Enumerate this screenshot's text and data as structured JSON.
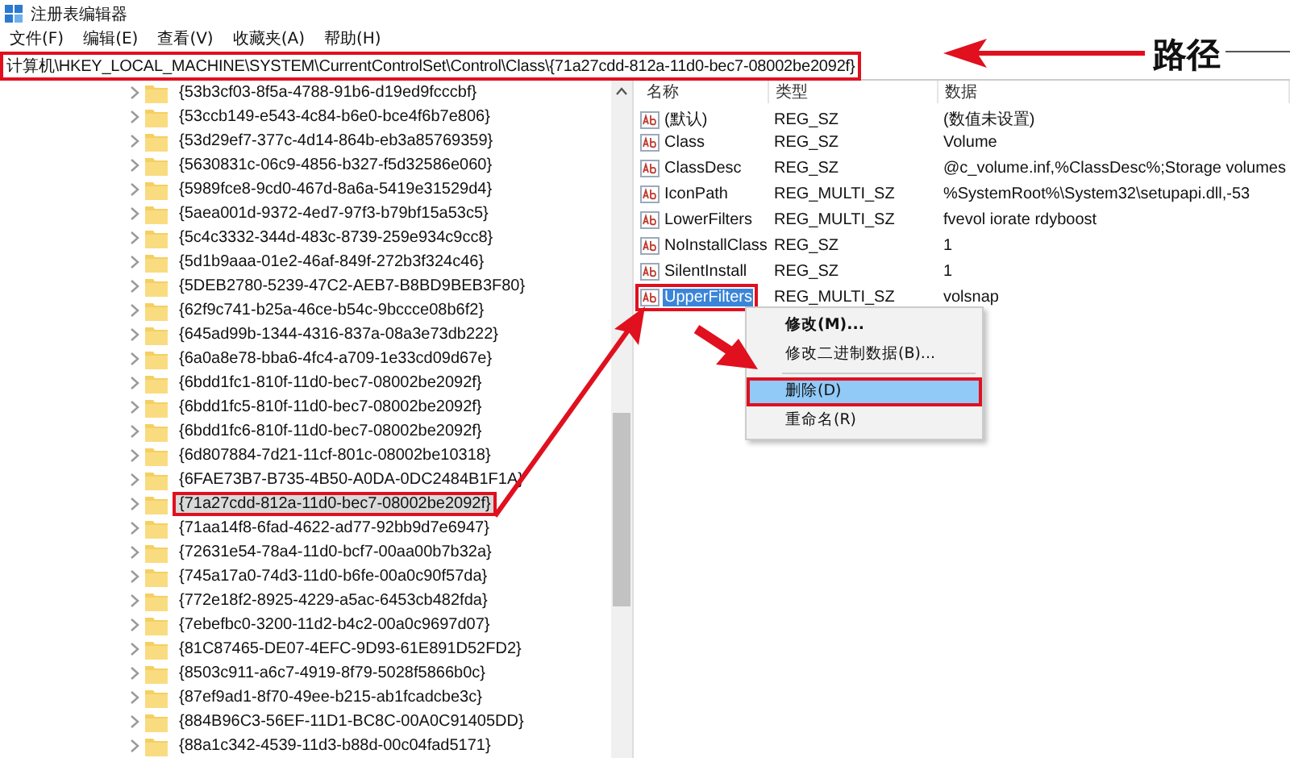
{
  "window": {
    "title": "注册表编辑器"
  },
  "menu_bar": [
    "文件(F)",
    "编辑(E)",
    "查看(V)",
    "收藏夹(A)",
    "帮助(H)"
  ],
  "address_bar": {
    "value": "计算机\\HKEY_LOCAL_MACHINE\\SYSTEM\\CurrentControlSet\\Control\\Class\\{71a27cdd-812a-11d0-bec7-08002be2092f}",
    "highlighted": true
  },
  "annotation": {
    "label": "路径"
  },
  "tree": {
    "items": [
      {
        "label": "{53b3cf03-8f5a-4788-91b6-d19ed9fcccbf}",
        "selected": false,
        "highlighted": false
      },
      {
        "label": "{53ccb149-e543-4c84-b6e0-bce4f6b7e806}",
        "selected": false,
        "highlighted": false
      },
      {
        "label": "{53d29ef7-377c-4d14-864b-eb3a85769359}",
        "selected": false,
        "highlighted": false
      },
      {
        "label": "{5630831c-06c9-4856-b327-f5d32586e060}",
        "selected": false,
        "highlighted": false
      },
      {
        "label": "{5989fce8-9cd0-467d-8a6a-5419e31529d4}",
        "selected": false,
        "highlighted": false
      },
      {
        "label": "{5aea001d-9372-4ed7-97f3-b79bf15a53c5}",
        "selected": false,
        "highlighted": false
      },
      {
        "label": "{5c4c3332-344d-483c-8739-259e934c9cc8}",
        "selected": false,
        "highlighted": false
      },
      {
        "label": "{5d1b9aaa-01e2-46af-849f-272b3f324c46}",
        "selected": false,
        "highlighted": false
      },
      {
        "label": "{5DEB2780-5239-47C2-AEB7-B8BD9BEB3F80}",
        "selected": false,
        "highlighted": false
      },
      {
        "label": "{62f9c741-b25a-46ce-b54c-9bccce08b6f2}",
        "selected": false,
        "highlighted": false
      },
      {
        "label": "{645ad99b-1344-4316-837a-08a3e73db222}",
        "selected": false,
        "highlighted": false
      },
      {
        "label": "{6a0a8e78-bba6-4fc4-a709-1e33cd09d67e}",
        "selected": false,
        "highlighted": false
      },
      {
        "label": "{6bdd1fc1-810f-11d0-bec7-08002be2092f}",
        "selected": false,
        "highlighted": false
      },
      {
        "label": "{6bdd1fc5-810f-11d0-bec7-08002be2092f}",
        "selected": false,
        "highlighted": false
      },
      {
        "label": "{6bdd1fc6-810f-11d0-bec7-08002be2092f}",
        "selected": false,
        "highlighted": false
      },
      {
        "label": "{6d807884-7d21-11cf-801c-08002be10318}",
        "selected": false,
        "highlighted": false
      },
      {
        "label": "{6FAE73B7-B735-4B50-A0DA-0DC2484B1F1A}",
        "selected": false,
        "highlighted": false
      },
      {
        "label": "{71a27cdd-812a-11d0-bec7-08002be2092f}",
        "selected": true,
        "highlighted": true
      },
      {
        "label": "{71aa14f8-6fad-4622-ad77-92bb9d7e6947}",
        "selected": false,
        "highlighted": false
      },
      {
        "label": "{72631e54-78a4-11d0-bcf7-00aa00b7b32a}",
        "selected": false,
        "highlighted": false
      },
      {
        "label": "{745a17a0-74d3-11d0-b6fe-00a0c90f57da}",
        "selected": false,
        "highlighted": false
      },
      {
        "label": "{772e18f2-8925-4229-a5ac-6453cb482fda}",
        "selected": false,
        "highlighted": false
      },
      {
        "label": "{7ebefbc0-3200-11d2-b4c2-00a0c9697d07}",
        "selected": false,
        "highlighted": false
      },
      {
        "label": "{81C87465-DE07-4EFC-9D93-61E891D52FD2}",
        "selected": false,
        "highlighted": false
      },
      {
        "label": "{8503c911-a6c7-4919-8f79-5028f5866b0c}",
        "selected": false,
        "highlighted": false
      },
      {
        "label": "{87ef9ad1-8f70-49ee-b215-ab1fcadcbe3c}",
        "selected": false,
        "highlighted": false
      },
      {
        "label": "{884B96C3-56EF-11D1-BC8C-00A0C91405DD}",
        "selected": false,
        "highlighted": false
      },
      {
        "label": "{88a1c342-4539-11d3-b88d-00c04fad5171}",
        "selected": false,
        "highlighted": false
      }
    ]
  },
  "values": {
    "columns": [
      "名称",
      "类型",
      "数据"
    ],
    "rows": [
      {
        "name": "(默认)",
        "type": "REG_SZ",
        "data": "(数值未设置)",
        "selected": false,
        "highlighted": false
      },
      {
        "name": "Class",
        "type": "REG_SZ",
        "data": "Volume",
        "selected": false,
        "highlighted": false
      },
      {
        "name": "ClassDesc",
        "type": "REG_SZ",
        "data": "@c_volume.inf,%ClassDesc%;Storage volumes",
        "selected": false,
        "highlighted": false
      },
      {
        "name": "IconPath",
        "type": "REG_MULTI_SZ",
        "data": "%SystemRoot%\\System32\\setupapi.dll,-53",
        "selected": false,
        "highlighted": false
      },
      {
        "name": "LowerFilters",
        "type": "REG_MULTI_SZ",
        "data": "fvevol iorate rdyboost",
        "selected": false,
        "highlighted": false
      },
      {
        "name": "NoInstallClass",
        "type": "REG_SZ",
        "data": "1",
        "selected": false,
        "highlighted": false
      },
      {
        "name": "SilentInstall",
        "type": "REG_SZ",
        "data": "1",
        "selected": false,
        "highlighted": false
      },
      {
        "name": "UpperFilters",
        "type": "REG_MULTI_SZ",
        "data": "volsnap",
        "selected": true,
        "highlighted": true
      }
    ]
  },
  "context_menu": {
    "items": [
      {
        "kind": "item",
        "label": "修改(M)...",
        "selected": false,
        "highlighted": false,
        "bold": true
      },
      {
        "kind": "item",
        "label": "修改二进制数据(B)...",
        "selected": false,
        "highlighted": false,
        "bold": false
      },
      {
        "kind": "separator"
      },
      {
        "kind": "item",
        "label": "删除(D)",
        "selected": true,
        "highlighted": true,
        "bold": false
      },
      {
        "kind": "item",
        "label": "重命名(R)",
        "selected": false,
        "highlighted": false,
        "bold": false
      }
    ]
  }
}
